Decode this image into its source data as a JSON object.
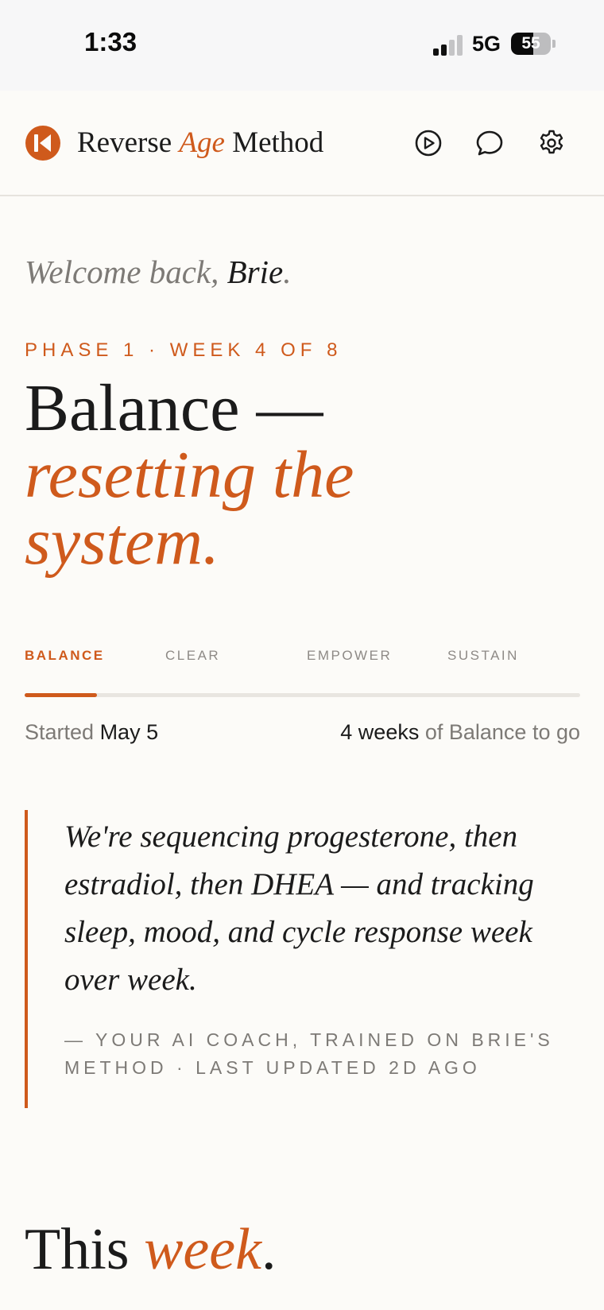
{
  "status_bar": {
    "time": "1:33",
    "network": "5G",
    "battery": "55",
    "battery_level": 0.55,
    "signal_bars_active": 2,
    "signal_bars_total": 4
  },
  "header": {
    "brand_part1": "Reverse ",
    "brand_accent": "Age",
    "brand_part2": " Method",
    "icons": [
      "play-circle-icon",
      "chat-bubble-icon",
      "gear-icon"
    ]
  },
  "greeting": {
    "prefix": "Welcome back, ",
    "name": "Brie",
    "suffix": "."
  },
  "phase_label": "PHASE 1 · WEEK 4 OF 8",
  "hero": {
    "line1": "Balance —",
    "line2": "resetting the",
    "line3": "system."
  },
  "tabs": [
    {
      "label": "BALANCE",
      "active": true
    },
    {
      "label": "CLEAR",
      "active": false
    },
    {
      "label": "EMPOWER",
      "active": false
    },
    {
      "label": "SUSTAIN",
      "active": false
    }
  ],
  "progress": 0.13,
  "started": {
    "prefix": "Started ",
    "date": "May 5"
  },
  "remaining": {
    "count": "4 weeks",
    "suffix": " of Balance to go"
  },
  "coach_quote": {
    "text": "We're sequencing progesterone, then estradiol, then DHEA — and tracking sleep, mood, and cycle response week over week.",
    "attribution": "— YOUR AI COACH, TRAINED ON BRIE'S METHOD · LAST UPDATED 2D AGO"
  },
  "section": {
    "title_plain": "This ",
    "title_accent": "week",
    "title_end": "."
  },
  "colors": {
    "accent": "#cf5a1c",
    "background": "#fcfbf8",
    "text": "#1b1b1b",
    "muted": "#7d7a76"
  }
}
